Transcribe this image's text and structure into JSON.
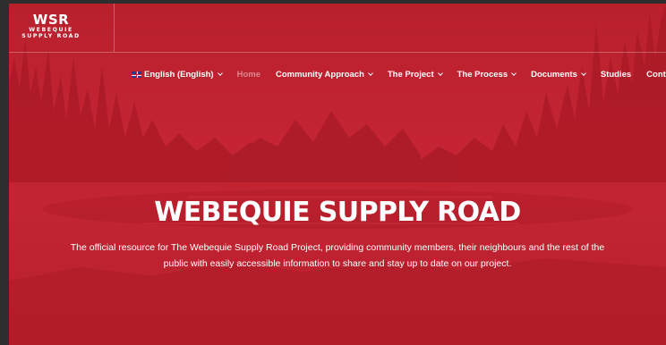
{
  "logo": {
    "main": "WSR",
    "line1": "WEBEQUIE",
    "line2": "SUPPLY ROAD"
  },
  "nav": {
    "language": "English (English)",
    "items": [
      {
        "label": "Home",
        "dropdown": false
      },
      {
        "label": "Community Approach",
        "dropdown": true
      },
      {
        "label": "The Project",
        "dropdown": true
      },
      {
        "label": "The Process",
        "dropdown": true
      },
      {
        "label": "Documents",
        "dropdown": true
      },
      {
        "label": "Studies",
        "dropdown": false
      },
      {
        "label": "Contact",
        "dropdown": false
      }
    ]
  },
  "hero": {
    "title": "WEBEQUIE SUPPLY ROAD",
    "description": "The official resource for The Webequie Supply Road Project, providing community members, their neighbours and the rest of the public with easily accessible information to share and stay up to date on our project."
  },
  "colors": {
    "brand_red": "#c22432",
    "frame": "#2e2e2e"
  }
}
